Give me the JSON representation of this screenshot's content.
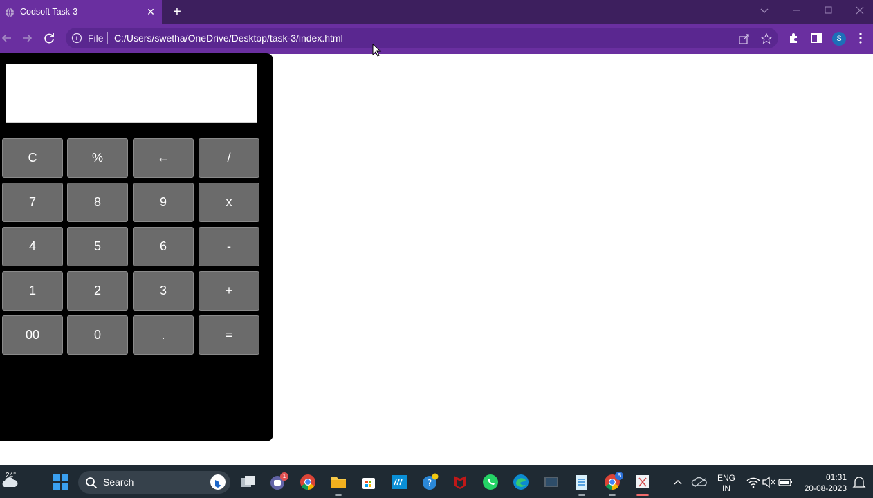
{
  "browser": {
    "tab_title": "Codsoft Task-3",
    "address_scheme": "File",
    "address_url": "C:/Users/swetha/OneDrive/Desktop/task-3/index.html",
    "profile_initial": "S",
    "theme_color": "#6a2fa0"
  },
  "calculator": {
    "display_value": "",
    "keys": [
      [
        "C",
        "%",
        "←",
        "/"
      ],
      [
        "7",
        "8",
        "9",
        "x"
      ],
      [
        "4",
        "5",
        "6",
        "-"
      ],
      [
        "1",
        "2",
        "3",
        "+"
      ],
      [
        "00",
        "0",
        ".",
        "="
      ]
    ],
    "key_color": "#6b6b6b",
    "body_color": "#000000"
  },
  "taskbar": {
    "weather_temp": "24°",
    "search_label": "Search",
    "teams_badge": "1",
    "chrome_badge": "8",
    "language_line1": "ENG",
    "language_line2": "IN",
    "time": "01:31",
    "date": "20-08-2023"
  }
}
